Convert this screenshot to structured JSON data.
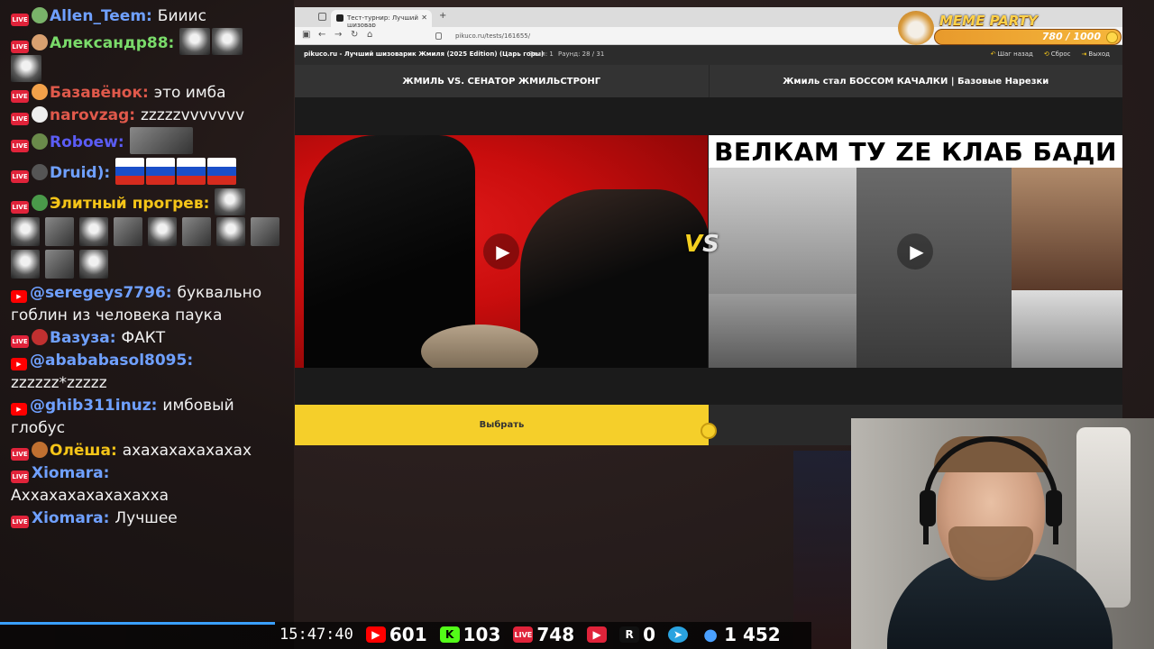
{
  "chat": [
    {
      "platform": "LIVE",
      "user": "Allen_Teem:",
      "color": "#6fa0ff",
      "text": "Бииис"
    },
    {
      "platform": "LIVE",
      "user": "Александр88:",
      "color": "#7adb6a",
      "text": ""
    },
    {
      "platform": "LIVE",
      "user": "Базавёнок:",
      "color": "#e0594b",
      "text": "это имба"
    },
    {
      "platform": "LIVE",
      "user": "narovzag:",
      "color": "#e0594b",
      "text": "zzzzzvvvvvvv"
    },
    {
      "platform": "LIVE",
      "user": "Roboew:",
      "color": "#5b5cf5",
      "text": ""
    },
    {
      "platform": "LIVE",
      "user": "Druid):",
      "color": "#6fa0ff",
      "text": ""
    },
    {
      "platform": "LIVE",
      "user": "Элитный прогрев:",
      "color": "#f5c518",
      "text": ""
    },
    {
      "platform": "YT",
      "user": "@seregeys7796:",
      "color": "#6fa0ff",
      "text": "буквально гоблин из человека паука"
    },
    {
      "platform": "LIVE",
      "user": "Вазуза:",
      "color": "#6fa0ff",
      "text": "ФАКТ"
    },
    {
      "platform": "YT",
      "user": "@abababasol8095:",
      "color": "#6fa0ff",
      "text": "zzzzzz*zzzzz"
    },
    {
      "platform": "YT",
      "user": "@ghib311inuz:",
      "color": "#6fa0ff",
      "text": "имбовый глобус"
    },
    {
      "platform": "LIVE",
      "user": "Олёша:",
      "color": "#f5c518",
      "text": "ахахахахахахах"
    },
    {
      "platform": "LIVE",
      "user": "Xiomara:",
      "color": "#6fa0ff",
      "text": "Аххахахахахахахха"
    },
    {
      "platform": "LIVE",
      "user": "Xiomara:",
      "color": "#6fa0ff",
      "text": "Лучшее"
    }
  ],
  "status": {
    "time": "15:47:40",
    "youtube": "601",
    "kick": "103",
    "live": "748",
    "twitch_icon": "play-icon",
    "rutube": "0",
    "telegram_icon": "telegram-icon",
    "viewers": "1 452"
  },
  "browser": {
    "tab_title": "Тест-турнир: Лучший шизовар",
    "url": "pikuco.ru/tests/161655/",
    "site_title": "pikuco.ru - Лучший шизоварик Жмиля (2025 Edition) (Царь горы)",
    "stage": "Этап: 1",
    "round": "Раунд: 28 / 31",
    "actions": {
      "back": "Шаг назад",
      "reset": "Сброс",
      "exit": "Выход"
    }
  },
  "battle": {
    "left_title": "ЖМИЛЬ VS. СЕНАТОР ЖМИЛЬСТРОНГ",
    "right_title": "Жмиль стал БОССОМ КАЧАЛКИ | Базовые Нарезки",
    "right_banner": "ВЕЛКАМ ТУ ZE КЛАБ БАДИ",
    "vs_v": "V",
    "vs_s": "S",
    "choose_label": "Выбрать"
  },
  "meme_party": {
    "logo": "MEME PARTY",
    "count": "780 / 1000"
  }
}
